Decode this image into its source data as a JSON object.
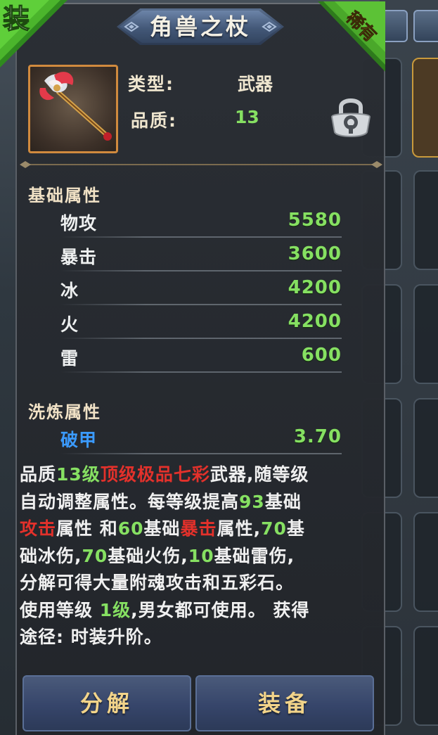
{
  "item": {
    "name": "角兽之杖",
    "equip_badge": "装",
    "rarity_badge": "稀有",
    "type_label": "类型:",
    "type_value": "武器",
    "quality_label": "品质:",
    "quality_value": "13"
  },
  "base_attributes": {
    "title": "基础属性",
    "stats": [
      {
        "name": "物攻",
        "value": "5580"
      },
      {
        "name": "暴击",
        "value": "3600"
      },
      {
        "name": "冰",
        "value": "4200"
      },
      {
        "name": "火",
        "value": "4200"
      },
      {
        "name": "雷",
        "value": "600"
      }
    ]
  },
  "refine_attributes": {
    "title": "洗炼属性",
    "stats": [
      {
        "name": "破甲",
        "value": "3.70",
        "name_color": "#3b9bff"
      }
    ]
  },
  "description": {
    "l1a": "品质",
    "l1b": "13级",
    "l1c": "顶级极品七彩",
    "l1d": "武器,随等级",
    "l2a": "自动调整属性。每等级提高",
    "l2b": "93",
    "l2c": "基础",
    "l3a": "攻击",
    "l3b": "属性 和",
    "l3c": "60",
    "l3d": "基础",
    "l3e": "暴击",
    "l3f": "属性,",
    "l3g": "70",
    "l3h": "基",
    "l4a": "础冰伤,",
    "l4b": "70",
    "l4c": "基础火伤,",
    "l4d": "10",
    "l4e": "基础雷伤,",
    "l5": "分解可得大量附魂攻击和五彩石。",
    "l6a": "使用等级 ",
    "l6b": "1级",
    "l6c": ",男女都可使用。 获得",
    "l7": "途径: 时装升阶。"
  },
  "buttons": {
    "decompose": "分解",
    "equip": "装备"
  },
  "colors": {
    "stat_value": "#86e062",
    "highlight_green": "#86e062",
    "highlight_red": "#e3312b",
    "refine_name": "#3b9bff",
    "button_text": "#f2d48a"
  }
}
